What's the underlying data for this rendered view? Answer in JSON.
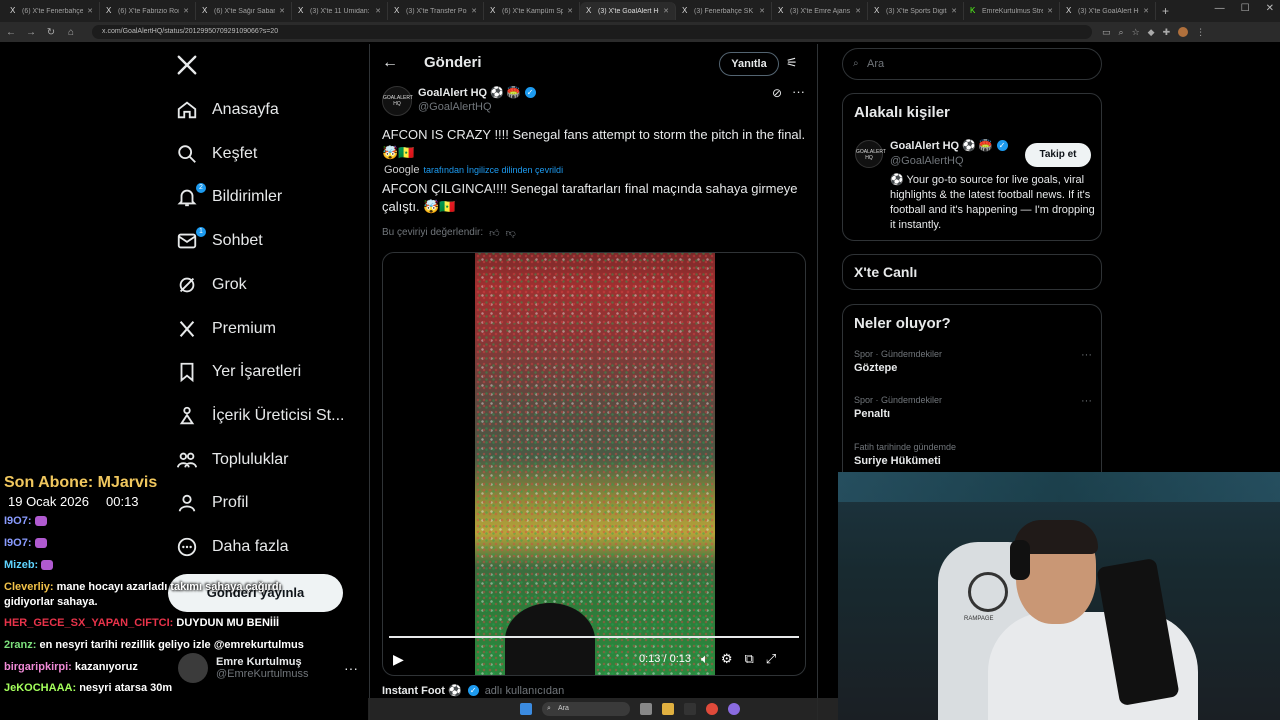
{
  "browser": {
    "tabs": [
      {
        "label": "(6) X'te Fenerbahçe SK",
        "icon": "x-icon"
      },
      {
        "label": "(6) X'te Fabrizio Romano",
        "icon": "x-icon"
      },
      {
        "label": "(6) X'te Sağır Sabancı",
        "icon": "x-icon"
      },
      {
        "label": "(3) X'te 11 Umidan: \"Ch",
        "icon": "x-icon"
      },
      {
        "label": "(3) X'te Transfer Postası",
        "icon": "x-icon"
      },
      {
        "label": "(6) X'te Kampüm Spor",
        "icon": "x-icon"
      },
      {
        "label": "(3) X'te GoalAlert HQ: A",
        "icon": "x-icon",
        "active": true
      },
      {
        "label": "(3) Fenerbahçe SK (@",
        "icon": "x-icon"
      },
      {
        "label": "(3) X'te Emre Ajans ne",
        "icon": "x-icon"
      },
      {
        "label": "(3) X'te Sports Digital",
        "icon": "x-icon"
      },
      {
        "label": "EmreKurtulmus Stream",
        "icon": "kick-icon"
      },
      {
        "label": "(3) X'te GoalAlert HQ: A",
        "icon": "x-icon"
      }
    ],
    "url": "x.com/GoalAlertHQ/status/2012995070929109066?s=20"
  },
  "nav": {
    "items": [
      {
        "label": "Anasayfa",
        "icon": "home-icon"
      },
      {
        "label": "Keşfet",
        "icon": "search-icon"
      },
      {
        "label": "Bildirimler",
        "icon": "bell-icon",
        "badge": "2"
      },
      {
        "label": "Sohbet",
        "icon": "mail-icon",
        "badge": "1"
      },
      {
        "label": "Grok",
        "icon": "grok-icon"
      },
      {
        "label": "Premium",
        "icon": "x-premium-icon"
      },
      {
        "label": "Yer İşaretleri",
        "icon": "bookmark-icon"
      },
      {
        "label": "İçerik Üreticisi St...",
        "icon": "creator-icon"
      },
      {
        "label": "Topluluklar",
        "icon": "communities-icon"
      },
      {
        "label": "Profil",
        "icon": "profile-icon"
      },
      {
        "label": "Daha fazla",
        "icon": "more-circle-icon"
      }
    ],
    "post_button": "Gönderi yayınla",
    "account": {
      "name": "Emre Kurtulmuş",
      "handle": "@EmreKurtulmuss"
    }
  },
  "post": {
    "header_title": "Gönderi",
    "reply_button": "Yanıtla",
    "author": {
      "name": "GoalAlert HQ ⚽ 🏟️",
      "handle": "@GoalAlertHQ",
      "avatar_text": "GOALALERT HQ"
    },
    "text": "AFCON IS CRAZY !!!! Senegal fans attempt to storm the pitch in the final. 🤯🇸🇳",
    "translation_provider": "Google",
    "translation_note": "tarafından İngilizce dilinden çevrildi",
    "translated_text": "AFCON ÇILGINCA!!!! Senegal taraftarları final maçında sahaya girmeye çalıştı. 🤯🇸🇳",
    "rate_translation": "Bu çeviriyi değerlendir:",
    "video": {
      "time": "0:13 / 0:13",
      "progress": 1.0
    },
    "quoted": {
      "name": "Instant Foot ⚽",
      "note": "adlı kullanıcıdan"
    }
  },
  "right": {
    "search_placeholder": "Ara",
    "related_title": "Alakalı kişiler",
    "related": {
      "name": "GoalAlert HQ ⚽ 🏟️",
      "handle": "@GoalAlertHQ",
      "follow_label": "Takip et",
      "bio": "⚽ Your go-to source for live goals, viral highlights & the latest football news. If it's football and it's happening — I'm dropping it instantly."
    },
    "live_title": "X'te Canlı",
    "trends_title": "Neler oluyor?",
    "trends": [
      {
        "context": "Spor · Gündemdekiler",
        "name": "Göztepe"
      },
      {
        "context": "Spor · Gündemdekiler",
        "name": "Penaltı"
      },
      {
        "context": "Fatih tarihinde gündemde",
        "name": "Suriye Hükümeti"
      }
    ]
  },
  "stream": {
    "last_sub": "Son Abone: MJarvis",
    "date": "19 Ocak 2026",
    "time": "00:13",
    "chair_brand": "RAMPAGE",
    "chat": [
      {
        "user": "I9O7:",
        "msg": "",
        "user_color": "#8a9cff",
        "emote": true
      },
      {
        "user": "I9O7:",
        "msg": "",
        "user_color": "#8a9cff",
        "emote": true
      },
      {
        "user": "Mizeb:",
        "msg": "",
        "user_color": "#5fd4ff",
        "emote": true
      },
      {
        "user": "Cleverliy:",
        "msg": "mane hocayı azarladı takımı sahaya çağırdı",
        "user_color": "#f3c34a"
      },
      {
        "user": "",
        "msg": "gidiyorlar sahaya.",
        "user_color": "#ffffff"
      },
      {
        "user": "HER_GECE_SX_YAPAN_CIFTCI:",
        "msg": "DUYDUN MU BENİİİ",
        "user_color": "#e8334a"
      },
      {
        "user": "2ranz:",
        "msg": "en nesyri tarihi rezillik geliyo izle @emrekurtulmus",
        "user_color": "#7de07d"
      },
      {
        "user": "birgaripkirpi:",
        "msg": "kazanıyoruz",
        "user_color": "#f08ad6"
      },
      {
        "user": "JeKOCHAAA:",
        "msg": "nesyri atarsa 30m",
        "user_color": "#a4ff5c"
      }
    ]
  },
  "taskbar": {
    "search_placeholder": "Ara"
  }
}
